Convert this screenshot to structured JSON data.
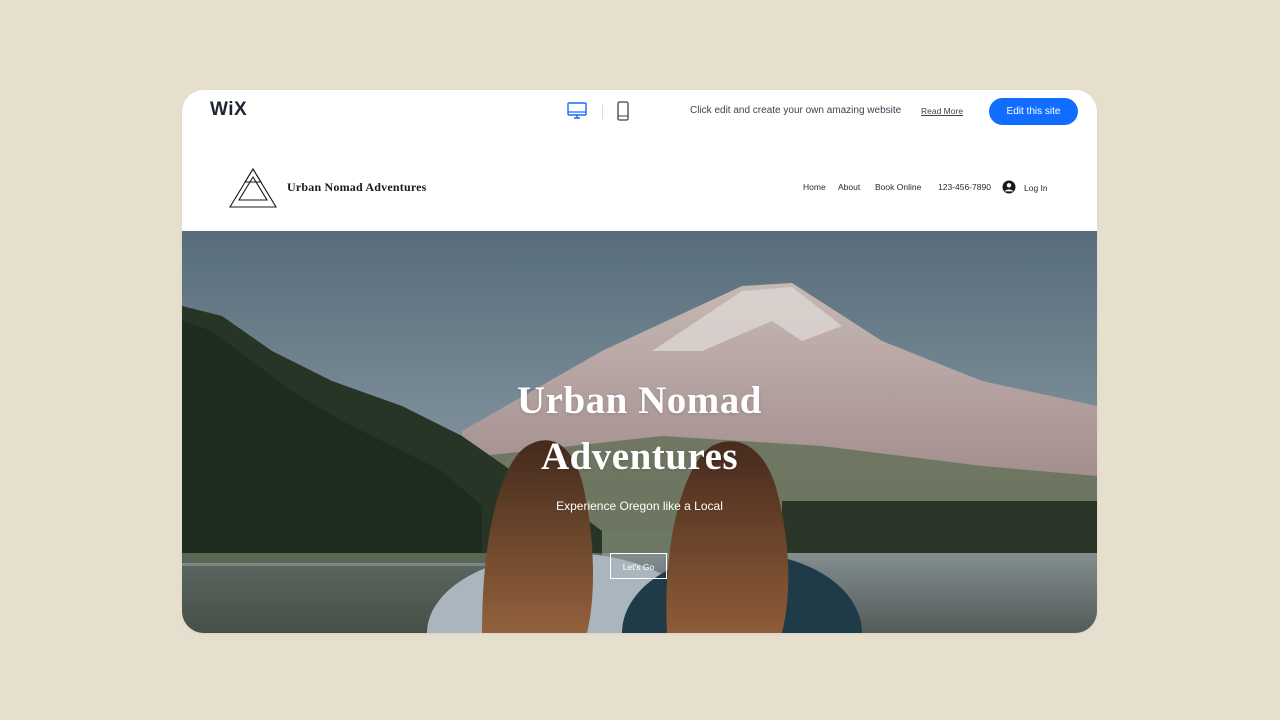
{
  "wix_bar": {
    "logo": "WiX",
    "promo_text": "Click edit and create your own amazing website",
    "read_more": "Read More",
    "edit_button": "Edit this site",
    "devices": [
      "desktop-icon",
      "mobile-icon"
    ]
  },
  "site": {
    "name": "Urban Nomad Adventures",
    "nav": {
      "home": "Home",
      "about": "About",
      "book": "Book Online",
      "phone": "123-456-7890",
      "login": "Log In"
    }
  },
  "hero": {
    "title_line1": "Urban Nomad",
    "title_line2": "Adventures",
    "subtitle": "Experience Oregon like a Local",
    "cta": "Let's Go"
  },
  "colors": {
    "page_bg": "#e7dfcd",
    "accent": "#116dff",
    "text_dark": "#1d2433"
  }
}
